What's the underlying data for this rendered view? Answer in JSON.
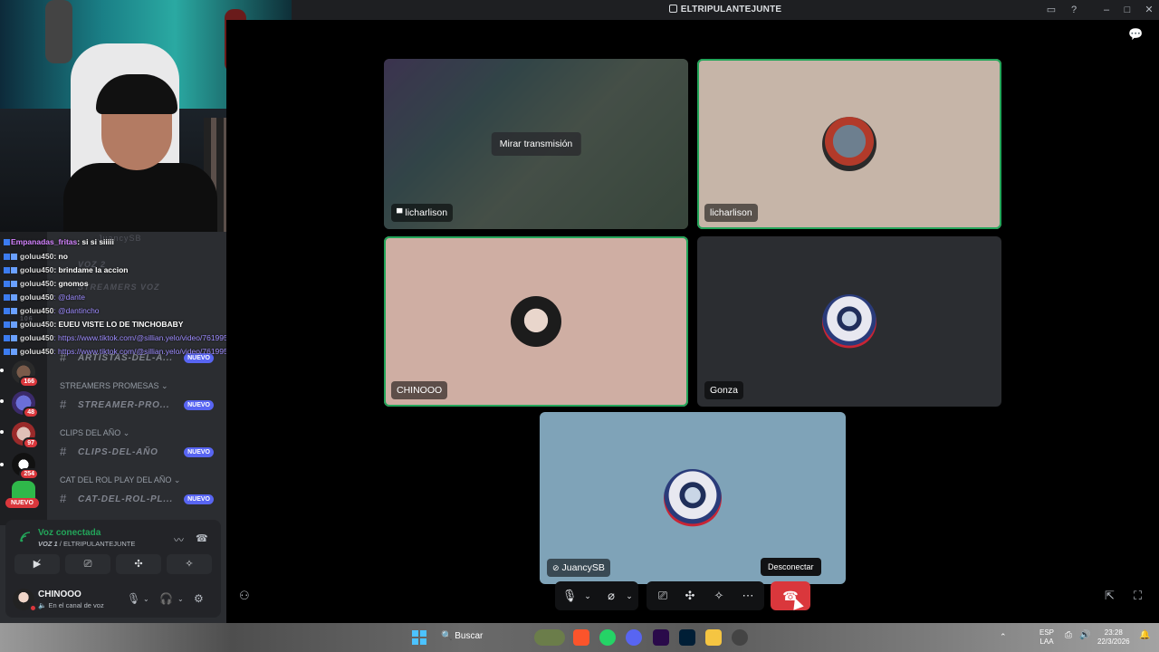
{
  "window": {
    "title": "ELTRIPULANTEJUNTE"
  },
  "chat": {
    "lines": [
      {
        "user": "Empanadas_fritas",
        "text": ": si si siiiii"
      },
      {
        "user": "goluu450",
        "text": ": no"
      },
      {
        "user": "goluu450",
        "text": ": brindame la accion"
      },
      {
        "user": "goluu450",
        "text": ": gnomos"
      },
      {
        "user": "goluu450",
        "text": ": @dante"
      },
      {
        "user": "goluu450",
        "text": ": @dantincho"
      },
      {
        "user": "goluu450",
        "text": ": EUEU VISTE LO DE TINCHOBABY"
      },
      {
        "user": "goluu450",
        "text": ": https://www.tiktok.com/@sillian.yelo/video/7619958162971561223"
      },
      {
        "user": "goluu450",
        "text": ": https://www.tiktok.com/@sillian.yelo/video/7619958162971561223"
      }
    ]
  },
  "ghost": {
    "user": "JuancySB",
    "voz2": "VOZ 2",
    "streamers": "STREAMERS VOZ",
    "count": "106",
    "artistas": "ARTISTAS-DEL-A..."
  },
  "sidebar": {
    "categories": [
      {
        "name": "STREAMERS PROMESAS",
        "channel": "STREAMER-PRO...",
        "badge": "NUEVO"
      },
      {
        "name": "CLIPS DEL AÑO",
        "channel": "CLIPS-DEL-AÑO",
        "badge": "NUEVO"
      },
      {
        "name": "CAT DEL ROL PLAY DEL AÑO",
        "channel": "CAT-DEL-ROL-PL...",
        "badge": "NUEVO"
      }
    ],
    "artistas_badge": "NUEVO",
    "guild_counts": [
      "166",
      "48",
      "97",
      "254"
    ],
    "nuevo_pill": "NUEVO"
  },
  "voice": {
    "status": "Voz conectada",
    "channel_prefix": "VOZ 1",
    "channel_server": " / ELTRIPULANTEJUNTE"
  },
  "user": {
    "name": "CHINOOO",
    "status": "En el canal de voz"
  },
  "tiles": [
    {
      "name": "licharlison",
      "watch": "Mirar transmisión"
    },
    {
      "name": "licharlison"
    },
    {
      "name": "CHINOOO"
    },
    {
      "name": "Gonza"
    },
    {
      "name": "JuancySB"
    }
  ],
  "tooltip": "Desconectar",
  "taskbar": {
    "search": "Buscar",
    "lang1": "ESP",
    "lang2": "LAA",
    "time": "23:28",
    "date": "22/3/2026"
  },
  "colors": {
    "accent": "#5865f2",
    "danger": "#da373c",
    "voice_green": "#23a55a"
  }
}
